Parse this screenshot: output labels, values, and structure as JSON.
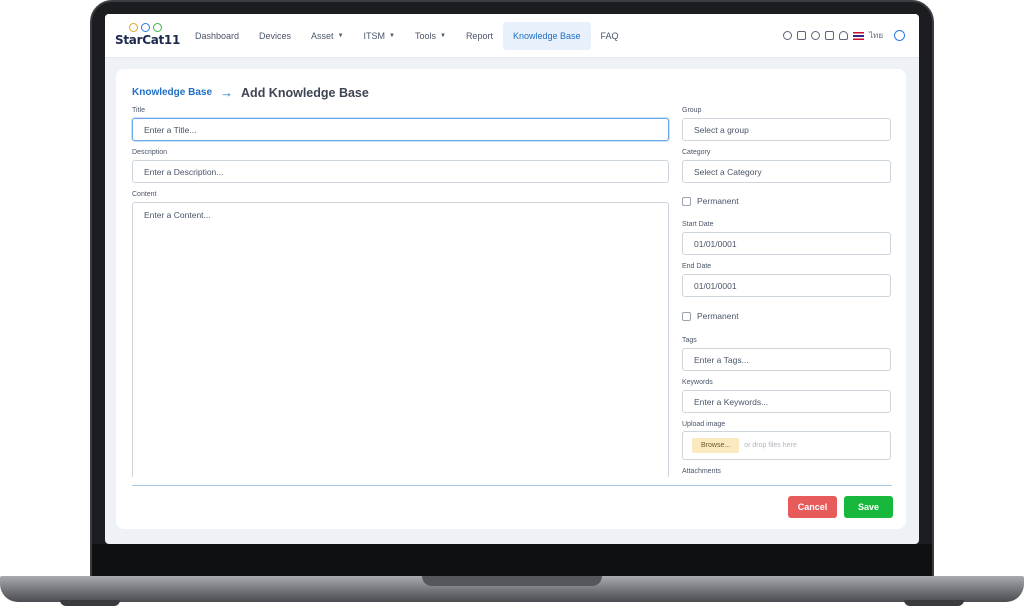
{
  "brand": {
    "logo_text": "StarCat11",
    "colors": {
      "dot1": "#e0a22c",
      "dot2": "#2d7be5",
      "dot3": "#3cb44b"
    }
  },
  "nav": {
    "items": [
      {
        "label": "Dashboard",
        "dropdown": false,
        "active": false
      },
      {
        "label": "Devices",
        "dropdown": false,
        "active": false
      },
      {
        "label": "Asset",
        "dropdown": true,
        "active": false
      },
      {
        "label": "ITSM",
        "dropdown": true,
        "active": false
      },
      {
        "label": "Tools",
        "dropdown": true,
        "active": false
      },
      {
        "label": "Report",
        "dropdown": false,
        "active": false
      },
      {
        "label": "Knowledge Base",
        "dropdown": false,
        "active": true
      },
      {
        "label": "FAQ",
        "dropdown": false,
        "active": false
      }
    ],
    "caret": "▼",
    "right_icons": [
      "circle-icon",
      "mail-icon",
      "timer-icon",
      "calendar-icon",
      "bell-icon",
      "flag-icon"
    ],
    "language": "ไทย"
  },
  "breadcrumb": {
    "link": "Knowledge Base",
    "arrow": "→",
    "current": "Add Knowledge Base"
  },
  "form": {
    "title": {
      "label": "Title",
      "placeholder": "Enter a Title..."
    },
    "description": {
      "label": "Description",
      "placeholder": "Enter a Description..."
    },
    "content": {
      "label": "Content",
      "placeholder": "Enter a Content..."
    },
    "group": {
      "label": "Group",
      "value": "Select a group"
    },
    "category": {
      "label": "Category",
      "value": "Select a Category"
    },
    "permanent_1": {
      "label": "Permanent",
      "checked": false
    },
    "start_date": {
      "label": "Start Date",
      "value": "01/01/0001"
    },
    "end_date": {
      "label": "End Date",
      "value": "01/01/0001"
    },
    "permanent_2": {
      "label": "Permanent",
      "checked": false
    },
    "tags": {
      "label": "Tags",
      "placeholder": "Enter a Tags..."
    },
    "keywords": {
      "label": "Keywords",
      "placeholder": "Enter a Keywords..."
    },
    "upload": {
      "label": "Upload image",
      "browse": "Browse...",
      "drop_hint": "or drop files here"
    },
    "attachments": {
      "label": "Attachments"
    }
  },
  "actions": {
    "cancel": "Cancel",
    "save": "Save"
  }
}
